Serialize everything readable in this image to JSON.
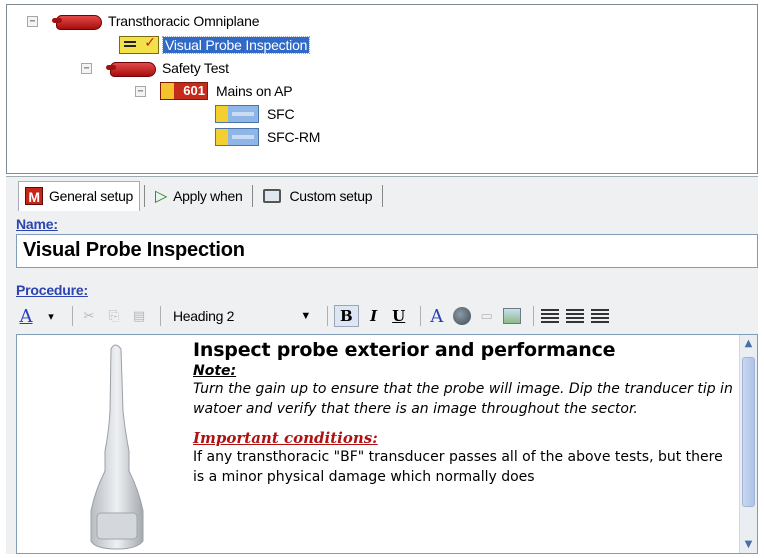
{
  "tree": {
    "root": {
      "label": "Transthoracic Omniplane",
      "expander": "−",
      "icon": "probe-icon"
    },
    "inspection": {
      "label": "Visual Probe Inspection",
      "icon": "inspection-icon"
    },
    "safety": {
      "label": "Safety Test",
      "expander": "−",
      "icon": "probe-icon"
    },
    "mains": {
      "label": "Mains on AP",
      "expander": "−",
      "icon": "test-601-icon",
      "badge": "601"
    },
    "sfc": {
      "label": "SFC",
      "icon": "sfc-test-icon"
    },
    "sfcrm": {
      "label": "SFC-RM",
      "icon": "sfc-test-icon"
    }
  },
  "tabs": {
    "general": "General setup",
    "apply": "Apply when",
    "custom": "Custom setup",
    "m_icon": "M"
  },
  "form": {
    "name_label": "Name:",
    "name_value": "Visual Probe Inspection",
    "procedure_label": "Procedure:"
  },
  "toolbar": {
    "style_button": "A",
    "style_dropdown": "▾",
    "heading_select": "Heading 2",
    "heading_arrow": "▼",
    "bold": "B",
    "italic": "I",
    "underline": "U",
    "font_color": "A",
    "cut": "✂",
    "copy": "⎘",
    "paste": "▤",
    "link": "▭"
  },
  "editor": {
    "heading": "Inspect probe exterior and performance",
    "note_heading": "Note:",
    "note_body": "Turn the gain up to ensure that the probe will image. Dip the tranducer tip in watoer and verify that there is an image throughout the sector.",
    "important_heading": "Important conditions:",
    "important_body": "If any transthoracic \"BF\" transducer passes all of the above tests, but there is a minor physical damage which normally does"
  },
  "scroll": {
    "up": "▲",
    "down": "▼"
  },
  "colors": {
    "selection": "#3169c6",
    "label_blue": "#2b44b0",
    "important_red": "#b01212",
    "panel_bg": "#eef0f2"
  }
}
